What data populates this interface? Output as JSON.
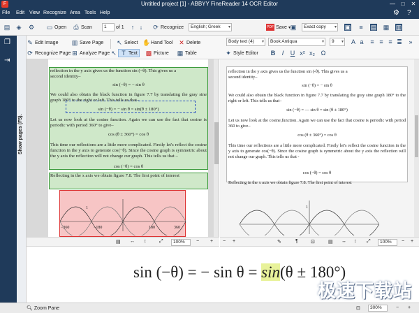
{
  "window": {
    "title": "Untitled project [1] - ABBYY FineReader 14 OCR Editor",
    "logo": "F",
    "controls": [
      "—",
      "□",
      "✕"
    ]
  },
  "menu": [
    "File",
    "Edit",
    "View",
    "Recognize",
    "Area",
    "Tools",
    "Help"
  ],
  "toolbar": {
    "open": "Open",
    "scan": "Scan",
    "page_num": "1",
    "of_pages": "of 1",
    "recognize": "Recognize",
    "language": "English; Greek",
    "save": "Save",
    "copy_mode": "Exact copy",
    "pdf_badge": "PDF"
  },
  "side": {
    "show_pages": "Show pages (F5)."
  },
  "image_tools": {
    "edit_image": "Edit Image",
    "save_page": "Save Page",
    "recognize_page": "Recognize Page",
    "analyze_page": "Analyze Page",
    "select": "Select",
    "hand_tool": "Hand Tool",
    "delete": "Delete",
    "text": "Text",
    "picture": "Picture",
    "table": "Table"
  },
  "text_tools": {
    "style": "Body text (4)",
    "font": "Book Antiqua",
    "size": "9",
    "style_editor": "Style Editor"
  },
  "image_doc": {
    "l1": "reflection in the y axis gives us the function sin (−θ).  This gives us a",
    "l2": "second identity–",
    "eq1": "sin (−θ) = − sin θ",
    "p2": "We could also obtain the black function in figure 7.7 by translating the gray sine graph 180° to the right or left. This tells us that–",
    "eq2": "sin (−θ) = − sin θ = sin(θ ± 180°)",
    "p3": "Let us now look at the cosine function.  Again we can use the fact that cosine is periodic with period 360° to give–",
    "eq3": "cos (θ ± 360°) = cos θ",
    "p4": "This time our reflections are a little more complicated. Firstly let's reflect the cosine function in the y axis to generate cos(−θ).  Since the cosine graph is symmetric about the y axis the reflection will not change our graph. This tells us that –",
    "eq4": "cos (−θ) = cos θ",
    "p5": "Reflecting in the x axis we obtain figure 7.8.  The first point of interest",
    "ticks": [
      "−360",
      "−180",
      "180",
      "360"
    ],
    "one": "1"
  },
  "text_doc": {
    "l1": "reflection in the y axis gives us the function sin (-θ). This gives us a",
    "l2": "second identity–",
    "eq1": "sin (−θ) = − sin θ",
    "p2": "We could also obtain the black function in figure 7.7 by translating the gray sine graph 180° to the right or left. This tells us that–",
    "eq2": "sin (−θ) = — sin θ = sin (θ ± 180°)",
    "p3": "Let us now look at the cosine,function. Again we can use the fact that cosine is periodic with period 360   to give–",
    "eq3": "cos (θ ± 360°) = cos θ",
    "p4": "This time our reflections are a little more complicated. Firstly let's reflect the cosine function in the y axis to generate cos(−θ). Since the cosine graph is symmetric about the y axis the reflection will not change our graph. This tells us that -",
    "eq4": "cos (−θ) = cos θ",
    "p5": "Reflecting in the x axis we obtain figure 7.8. The first point of interest",
    "one": "1"
  },
  "zoom": {
    "image_zoom": "100%",
    "text_zoom": "100%",
    "pane_zoom": "300%"
  },
  "zoom_pane": {
    "eq_a": "sin (−θ) = − sin θ = ",
    "eq_b": "sin",
    "eq_c": "(θ ± 180°)",
    "label": "Zoom Pane"
  },
  "watermark": "极速下载站",
  "colors": {
    "chrome": "#1f3a5a",
    "area_text": "#cfe8c9",
    "area_picture": "#f7c5c5",
    "accent": "#e23a2a"
  }
}
